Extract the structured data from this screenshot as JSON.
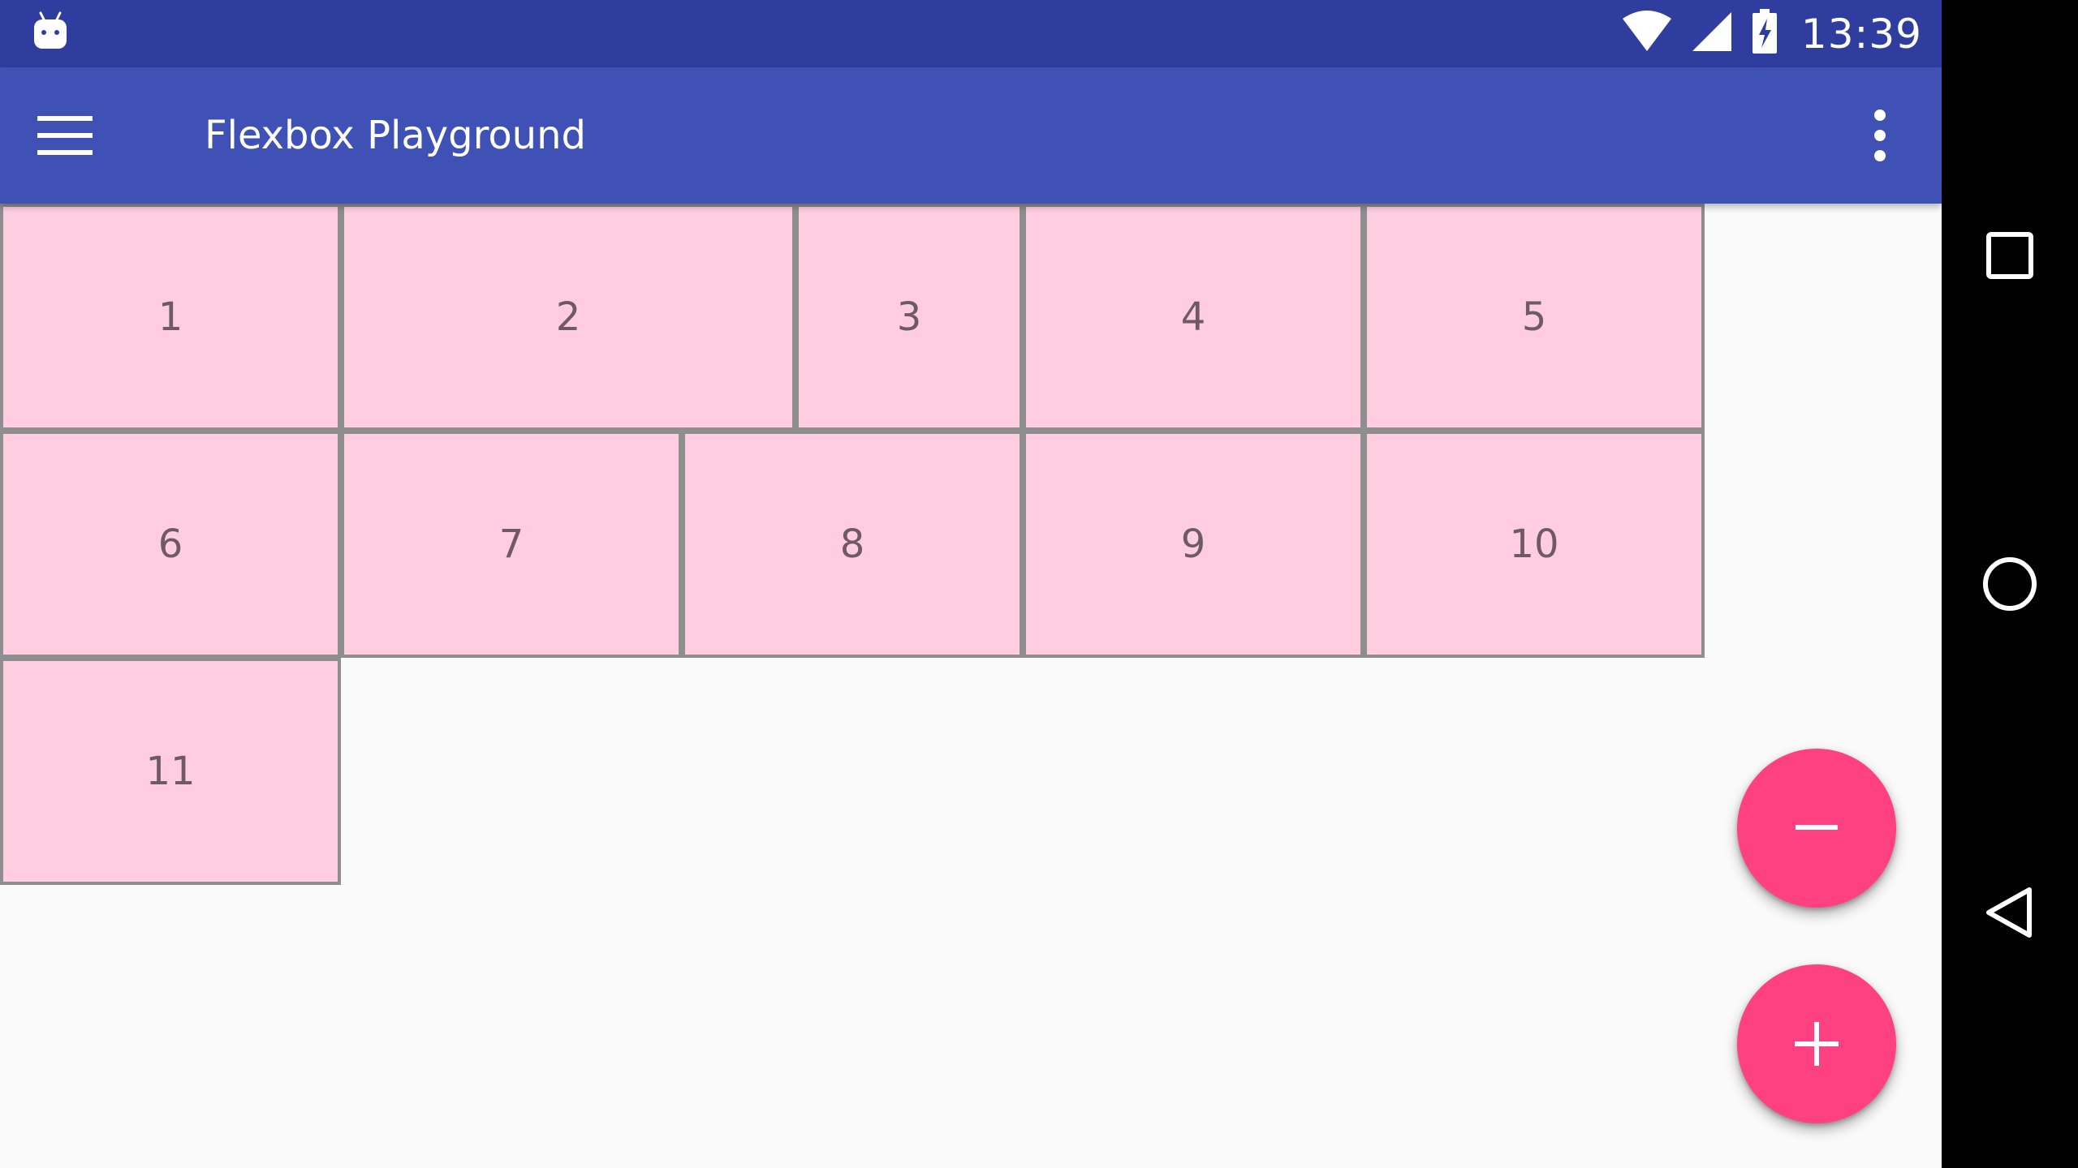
{
  "status_bar": {
    "time": "13:39",
    "icons": [
      "android-icon",
      "wifi-icon",
      "cell-signal-icon",
      "battery-charging-icon"
    ]
  },
  "app_bar": {
    "title": "Flexbox Playground",
    "icons": [
      "hamburger-menu-icon",
      "overflow-menu-icon"
    ]
  },
  "flex_items": [
    "1",
    "2",
    "3",
    "4",
    "5",
    "6",
    "7",
    "8",
    "9",
    "10",
    "11"
  ],
  "fabs": {
    "remove_icon": "minus-icon",
    "add_icon": "plus-icon",
    "color": "#ff4081"
  },
  "nav_bar": {
    "icons": [
      "recents-square-icon",
      "home-circle-icon",
      "back-triangle-icon"
    ]
  },
  "colors": {
    "status_bar": "#2f3e9e",
    "app_bar": "#3f51b5",
    "item_fill": "#ffcddf",
    "item_border": "#8e8e8e",
    "background": "#fafafa"
  }
}
